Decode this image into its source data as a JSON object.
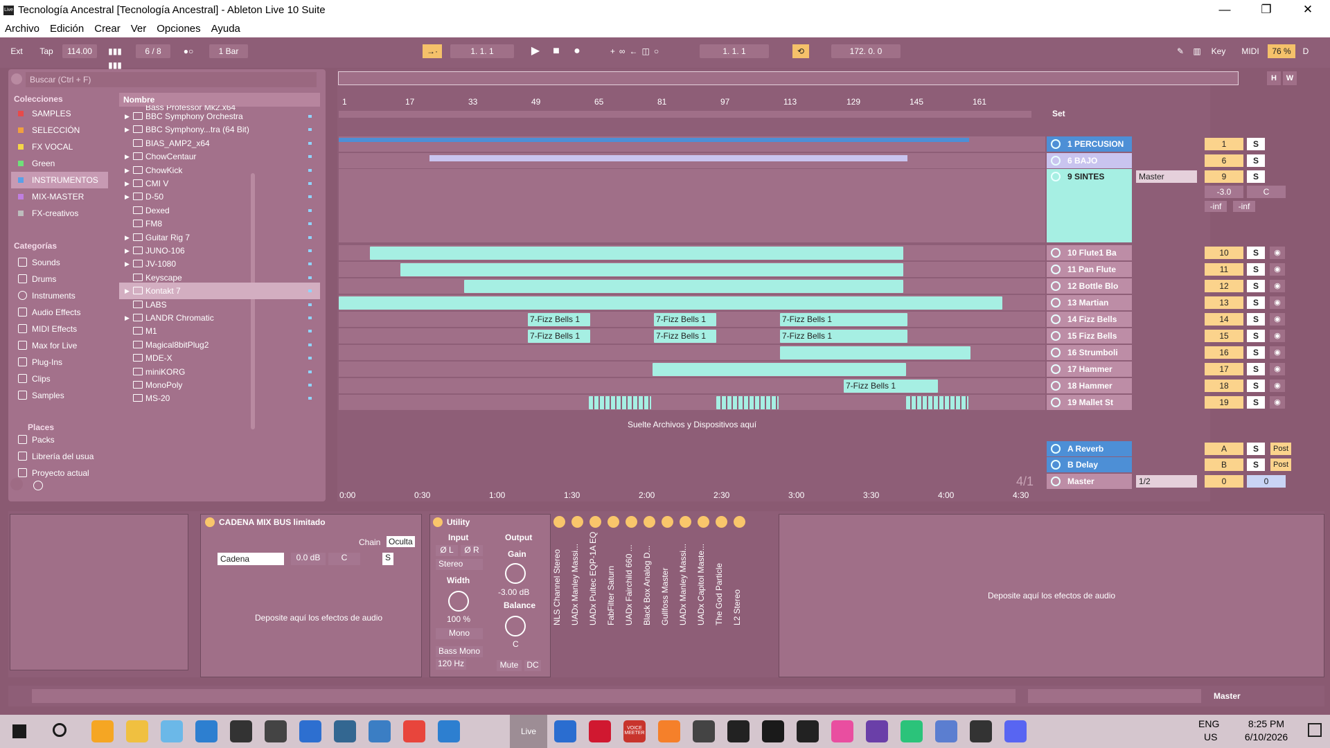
{
  "window": {
    "title": "Tecnología Ancestral  [Tecnología Ancestral] - Ableton Live 10 Suite",
    "logo": "Live",
    "min": "—",
    "max": "❐",
    "close": "✕"
  },
  "menu": [
    "Archivo",
    "Edición",
    "Crear",
    "Ver",
    "Opciones",
    "Ayuda"
  ],
  "transport": {
    "ext": "Ext",
    "tap": "Tap",
    "tempo": "114.00",
    "sig": "6  /  8",
    "metro": "●○",
    "quant": "1 Bar",
    "pos": "1.   1.   1",
    "loop_start": "1.   1.   1",
    "loop_len": "172.   0.   0",
    "key": "Key",
    "midi": "MIDI",
    "cpu": "76 %",
    "d": "D"
  },
  "browser": {
    "search": "Buscar (Ctrl + F)",
    "collections_title": "Colecciones",
    "collections": [
      {
        "label": "SAMPLES",
        "color": "#e84a4a"
      },
      {
        "label": "SELECCIÓN",
        "color": "#f0a040"
      },
      {
        "label": "FX VOCAL",
        "color": "#f5d547"
      },
      {
        "label": "Green",
        "color": "#6fe07a"
      },
      {
        "label": "INSTRUMENTOS",
        "color": "#5aa0e8"
      },
      {
        "label": "MIX-MASTER",
        "color": "#c07ee0"
      },
      {
        "label": "FX-creativos",
        "color": "#bdbdbd"
      }
    ],
    "categories_title": "Categorías",
    "categories": [
      "Sounds",
      "Drums",
      "Instruments",
      "Audio Effects",
      "MIDI Effects",
      "Max for Live",
      "Plug-Ins",
      "Clips",
      "Samples"
    ],
    "places_title": "Places",
    "places": [
      "Packs",
      "Librería del usua",
      "Proyecto actual"
    ],
    "col_name": "Nombre",
    "partial": "Bass Professor Mk2.x64",
    "items": [
      "BBC Symphony Orchestra",
      "BBC Symphony...tra (64 Bit)",
      "BIAS_AMP2_x64",
      "ChowCentaur",
      "ChowKick",
      "CMI V",
      "D-50",
      "Dexed",
      "FM8",
      "Guitar Rig 7",
      "JUNO-106",
      "JV-1080",
      "Keyscape",
      "Kontakt 7",
      "LABS",
      "LANDR Chromatic",
      "M1",
      "Magical8bitPlug2",
      "MDE-X",
      "miniKORG",
      "MonoPoly",
      "MS-20"
    ]
  },
  "ruler": [
    "1",
    "17",
    "33",
    "49",
    "65",
    "81",
    "97",
    "113",
    "129",
    "145",
    "161"
  ],
  "times": [
    "0:00",
    "0:30",
    "1:00",
    "1:30",
    "2:00",
    "2:30",
    "3:00",
    "3:30",
    "4:00",
    "4:30"
  ],
  "sig_label": "4/1",
  "drop_text": "Suelte Archivos y Dispositivos aquí",
  "clip_name": "7-Fizz Bells 1",
  "set_label": "Set",
  "tracks": [
    {
      "name": "1 PERCUSION",
      "vol": "1"
    },
    {
      "name": "6 BAJO",
      "vol": "6"
    },
    {
      "name": "9 SINTES",
      "vol": "9",
      "route": "Master",
      "level": "-3.0",
      "pan": "C",
      "inf1": "-inf",
      "inf2": "-inf"
    },
    {
      "name": "10 Flute1 Ba",
      "vol": "10"
    },
    {
      "name": "11 Pan Flute",
      "vol": "11"
    },
    {
      "name": "12 Bottle Blo",
      "vol": "12"
    },
    {
      "name": "13 Martian",
      "vol": "13"
    },
    {
      "name": "14 Fizz Bells",
      "vol": "14"
    },
    {
      "name": "15 Fizz Bells",
      "vol": "15"
    },
    {
      "name": "16 Strumboli",
      "vol": "16"
    },
    {
      "name": "17 Hammer",
      "vol": "17"
    },
    {
      "name": "18 Hammer",
      "vol": "18"
    },
    {
      "name": "19 Mallet St",
      "vol": "19"
    }
  ],
  "returns": [
    {
      "name": "A Reverb",
      "vol": "A",
      "post": "Post"
    },
    {
      "name": "B Delay",
      "vol": "B",
      "post": "Post"
    },
    {
      "name": "Master",
      "vol": "0",
      "route": "1/2",
      "vol2": "0"
    }
  ],
  "solo": "S",
  "device": {
    "rack": "CADENA MIX BUS limitado",
    "chain_lbl": "Chain",
    "chain_hide": "Oculta",
    "chain_name": "Cadena",
    "chain_db": "0.0 dB",
    "chain_pan": "C",
    "chain_s": "S",
    "drop": "Deposite aquí los efectos de audio",
    "utility": "Utility",
    "input": "Input",
    "output": "Output",
    "phl": "Ø L",
    "phr": "Ø R",
    "stereo": "Stereo",
    "width": "Width",
    "width_val": "100 %",
    "mono": "Mono",
    "bassmono": "Bass Mono",
    "hz": "120 Hz",
    "gain": "Gain",
    "gain_val": "-3.00 dB",
    "balance": "Balance",
    "bal_val": "C",
    "mute": "Mute",
    "dc": "DC",
    "plugins": [
      "NLS Channel Stereo",
      "UADx Manley Massi...",
      "UADx Pultec EQP-1A EQ",
      "FabFilter Saturn",
      "UADx Fairchild 660 ...",
      "Black Box Analog D...",
      "Gullfoss Master",
      "UADx Manley Massi...",
      "UADx Capitol Maste...",
      "The God Particle",
      "L2 Stereo"
    ],
    "drop2": "Deposite aquí los efectos de audio"
  },
  "status": {
    "master": "Master"
  },
  "taskbar": {
    "lang": "ENG",
    "region": "US",
    "time": "8:25 PM",
    "date": "6/10/2026",
    "live": "Live",
    "voicemeeter": "VOICE MEETER"
  }
}
